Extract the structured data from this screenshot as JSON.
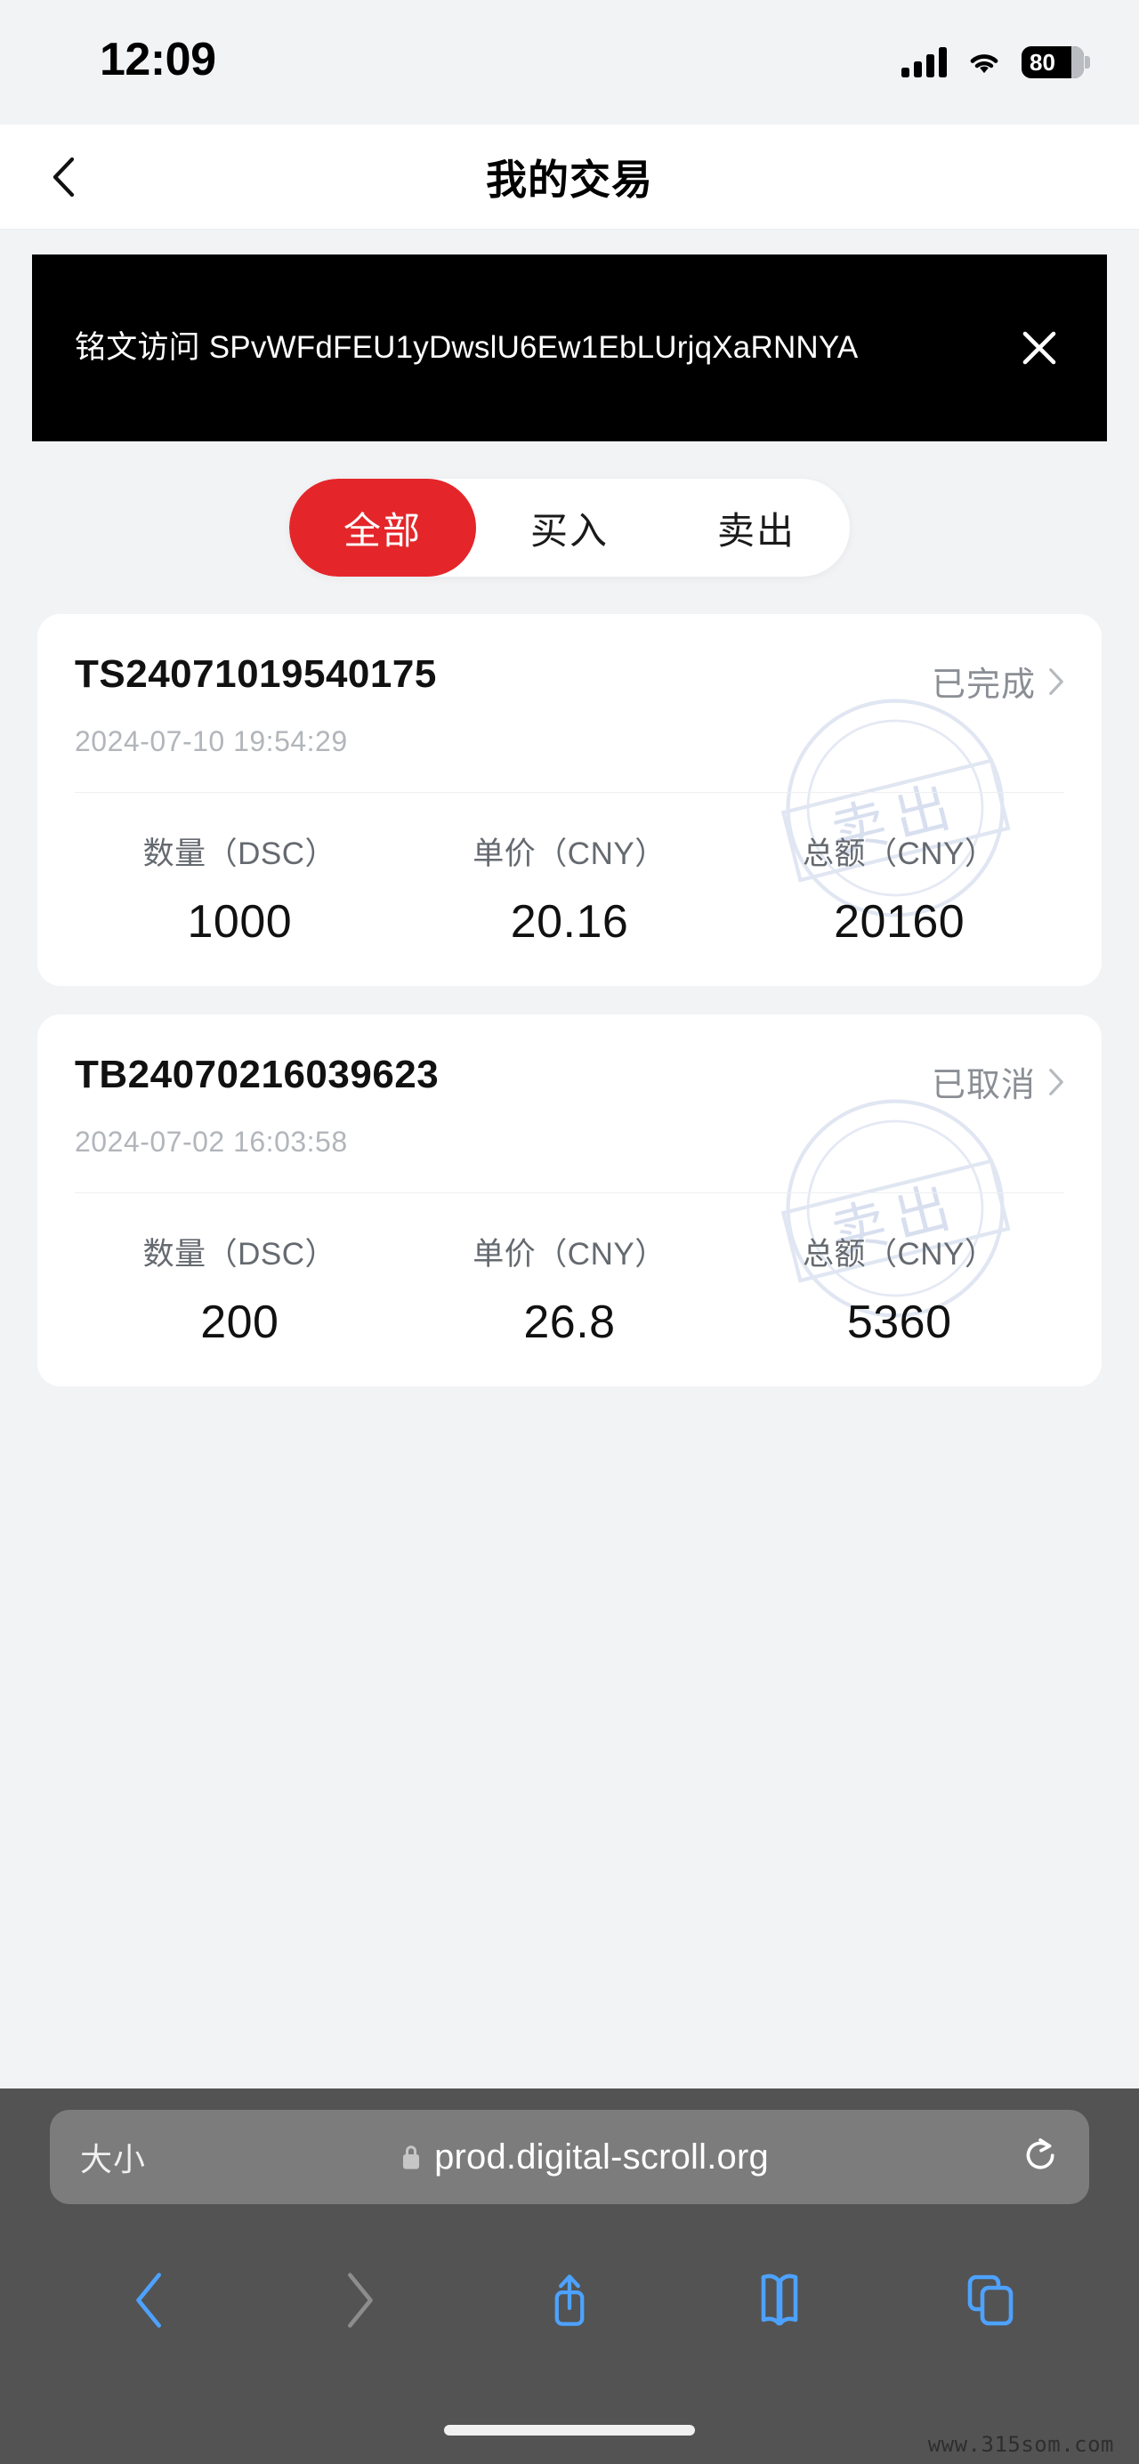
{
  "status_bar": {
    "time": "12:09",
    "battery_percent": "80",
    "signal_icon": "cellular-bars-icon",
    "wifi_icon": "wifi-icon",
    "battery_icon": "battery-icon"
  },
  "header": {
    "title": "我的交易",
    "back_icon": "chevron-left-icon"
  },
  "banner": {
    "text": "铭文访问 SPvWFdFEU1yDwslU6Ew1EbLUrjqXaRNNYA",
    "close_icon": "close-x-icon"
  },
  "tabs": {
    "active_index": 0,
    "active_color": "#e4262a",
    "items": [
      {
        "label": "全部"
      },
      {
        "label": "买入"
      },
      {
        "label": "卖出"
      }
    ]
  },
  "transactions": {
    "column_labels": [
      "数量（DSC）",
      "单价（CNY）",
      "总额（CNY）"
    ],
    "chevron_icon": "chevron-right-icon",
    "seal_icon": "sell-stamp-watermark",
    "items": [
      {
        "order_id": "TS24071019540175",
        "datetime": "2024-07-10 19:54:29",
        "status": "已完成",
        "seal_text": "卖出",
        "quantity": "1000",
        "unit_price": "20.16",
        "total": "20160"
      },
      {
        "order_id": "TB24070216039623",
        "datetime": "2024-07-02 16:03:58",
        "status": "已取消",
        "seal_text": "卖出",
        "quantity": "200",
        "unit_price": "26.8",
        "total": "5360"
      }
    ]
  },
  "browser": {
    "text_size_label": "大小",
    "lock_icon": "lock-icon",
    "url": "prod.digital-scroll.org",
    "reload_icon": "reload-icon",
    "toolbar": [
      {
        "name": "back-icon",
        "enabled": true
      },
      {
        "name": "forward-icon",
        "enabled": false
      },
      {
        "name": "share-icon",
        "enabled": true
      },
      {
        "name": "bookmarks-icon",
        "enabled": true
      },
      {
        "name": "tabs-icon",
        "enabled": true
      }
    ],
    "home_indicator": "home-indicator"
  },
  "watermark": {
    "text": "www.315som.com"
  }
}
